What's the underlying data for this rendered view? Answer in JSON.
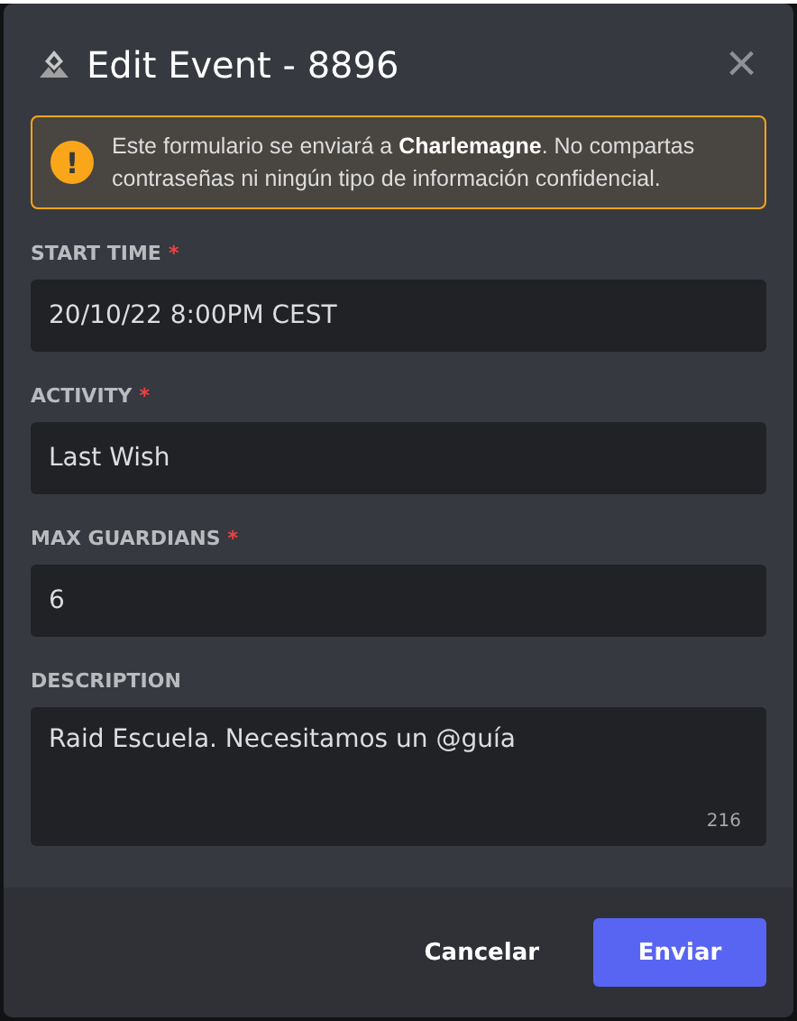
{
  "dialog": {
    "title": "Edit Event - 8896",
    "close": "×"
  },
  "notice": {
    "icon": "!",
    "text": "Este formulario se enviará a **Charlemagne**. No compartas contraseñas ni ningún tipo de información confidencial."
  },
  "fields": [
    {
      "kind": "input",
      "label": "START TIME",
      "required_mark": "*",
      "value": "20/10/22 8:00PM CEST"
    },
    {
      "kind": "input",
      "label": "ACTIVITY",
      "required_mark": "*",
      "value": "Last Wish"
    },
    {
      "kind": "input",
      "label": "MAX GUARDIANS",
      "required_mark": "*",
      "value": "6"
    },
    {
      "kind": "textarea",
      "label": "DESCRIPTION",
      "value": "Raid Escuela. Necesitamos un @guía",
      "counter": "216"
    }
  ],
  "buttons": [
    {
      "kind": "link",
      "label": "Cancelar"
    },
    {
      "kind": "primary",
      "label": "Enviar"
    }
  ]
}
